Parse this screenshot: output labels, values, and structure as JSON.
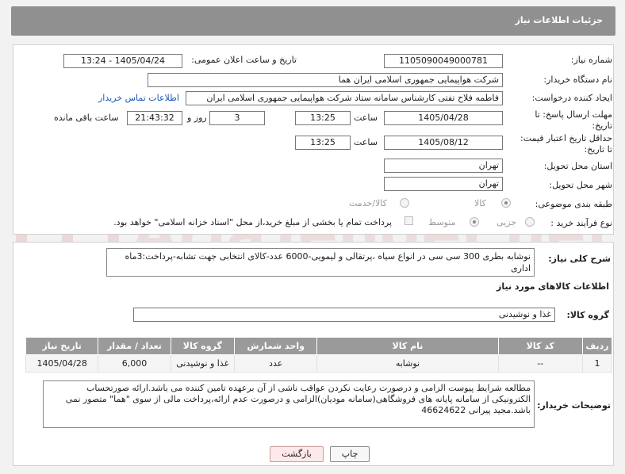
{
  "header": {
    "title": "جزئیات اطلاعات نیاز"
  },
  "form": {
    "need_number_label": "شماره نیاز:",
    "need_number": "1105090049000781",
    "announce_label": "تاریخ و ساعت اعلان عمومی:",
    "announce_value": "1405/04/24 - 13:24",
    "buyer_org_label": "نام دستگاه خریدار:",
    "buyer_org": "شرکت هواپیمایی جمهوری اسلامی ایران هما",
    "requester_label": "ایجاد کننده درخواست:",
    "requester": "فاطمه فلاح تفتی کارشناس سامانه ستاد شرکت هواپیمایی جمهوری اسلامی ایران",
    "contact_link": "اطلاعات تماس خریدار",
    "reply_deadline_label1": "مهلت ارسال پاسخ: تا",
    "reply_deadline_label2": "تاریخ:",
    "reply_date": "1405/04/28",
    "time_label": "ساعت",
    "reply_time": "13:25",
    "days_value": "3",
    "days_label": "روز و",
    "remaining_time": "21:43:32",
    "remaining_label": "ساعت باقی مانده",
    "price_validity_label1": "حداقل تاریخ اعتبار قیمت:",
    "price_validity_label2": "تا تاریخ:",
    "price_date": "1405/08/12",
    "price_time": "13:25",
    "province_label": "استان محل تحویل:",
    "province": "تهران",
    "city_label": "شهر محل تحویل:",
    "city": "تهران",
    "category_label": "طبقه بندی موضوعی:",
    "category_options": [
      "کالا",
      "کالا/خدمت"
    ],
    "process_label": "نوع فرآیند خرید :",
    "process_options": [
      "جزیی",
      "متوسط"
    ],
    "payment_note": "پرداخت تمام یا بخشی از مبلغ خرید،از محل \"اسناد خزانه اسلامی\" خواهد بود."
  },
  "description": {
    "label": "شرح کلی نیاز:",
    "text": "نوشابه بطری 300 سی سی در انواع سیاه ،پرتقالی و لیمویی-6000 عدد-کالای انتخابی جهت تشابه-پرداخت:3ماه اداری"
  },
  "goods": {
    "section_title": "اطلاعات کالاهای مورد نیاز",
    "group_label": "گروه کالا:",
    "group_value": "غذا و نوشیدنی",
    "columns": [
      "ردیف",
      "کد کالا",
      "نام کالا",
      "واحد شمارش",
      "گروه کالا",
      "تعداد / مقدار",
      "تاریخ نیاز"
    ],
    "rows": [
      [
        "1",
        "--",
        "نوشابه",
        "عدد",
        "غذا و نوشیدنی",
        "6,000",
        "1405/04/28"
      ]
    ]
  },
  "buyer_notes": {
    "label": "توضیحات خریدار:",
    "text": "مطالعه شرایط پیوست الزامی و درصورت رعایت نکردن عواقب ناشی از آن برعهده تامین کننده می باشد.ارائه صورتحساب الکترونیکی از سامانه پایانه های فروشگاهی(سامانه مودیان)الزامی و درصورت عدم ارائه،پرداخت مالی از سوی \"هما\" متصور نمی باشد.مجید پیرانی 46624622"
  },
  "buttons": {
    "print": "چاپ",
    "back": "بازگشت"
  },
  "watermark": {
    "text": "AriaTender.net"
  },
  "colors": {
    "header_bg": "#909090",
    "table_header_bg": "#9a9a9a",
    "link": "#1a57b8",
    "back_bg": "#fde9e9"
  }
}
